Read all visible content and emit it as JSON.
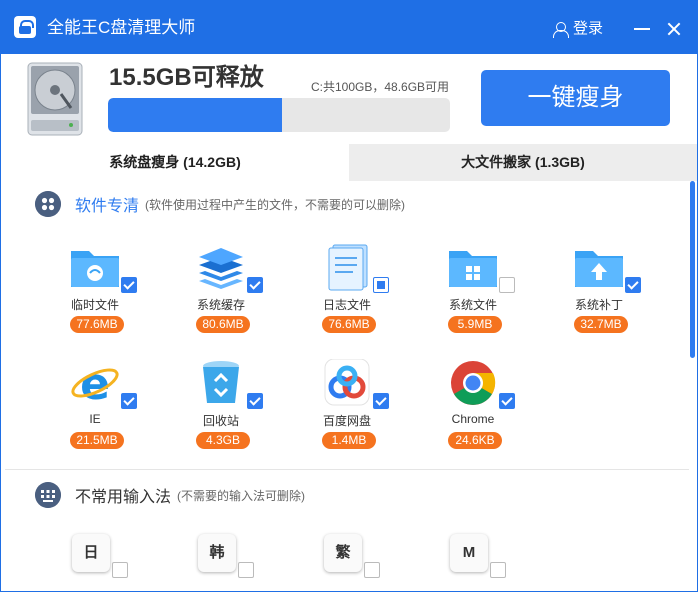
{
  "window": {
    "title": "全能王C盘清理大师",
    "login_label": "登录"
  },
  "header": {
    "free_space": "15.5GB可释放",
    "disk_info": "C:共100GB，48.6GB可用",
    "progress_fraction": 0.51,
    "slim_button": "一键瘦身"
  },
  "tabs": [
    {
      "label": "系统盘瘦身 (14.2GB)",
      "active": true
    },
    {
      "label": "大文件搬家 (1.3GB)",
      "active": false
    }
  ],
  "software_section": {
    "title": "软件专清",
    "hint": "(软件使用过程中产生的文件，不需要的可以删除)",
    "items": [
      {
        "label": "临时文件",
        "size": "77.6MB",
        "checked": true,
        "icon": "temp-folder-icon"
      },
      {
        "label": "系统缓存",
        "size": "80.6MB",
        "checked": true,
        "icon": "layers-icon"
      },
      {
        "label": "日志文件",
        "size": "76.6MB",
        "checked": "partial",
        "icon": "log-file-icon"
      },
      {
        "label": "系统文件",
        "size": "5.9MB",
        "checked": false,
        "icon": "windows-folder-icon"
      },
      {
        "label": "系统补丁",
        "size": "32.7MB",
        "checked": true,
        "icon": "patch-folder-icon"
      },
      {
        "label": "IE",
        "size": "21.5MB",
        "checked": true,
        "icon": "ie-icon"
      },
      {
        "label": "回收站",
        "size": "4.3GB",
        "checked": true,
        "icon": "recycle-bin-icon"
      },
      {
        "label": "百度网盘",
        "size": "1.4MB",
        "checked": true,
        "icon": "baidu-netdisk-icon"
      },
      {
        "label": "Chrome",
        "size": "24.6KB",
        "checked": true,
        "icon": "chrome-icon"
      }
    ]
  },
  "ime_section": {
    "title": "不常用输入法",
    "hint": "(不需要的输入法可删除)",
    "items": [
      {
        "key": "日",
        "checked": false
      },
      {
        "key": "韩",
        "checked": false
      },
      {
        "key": "繁",
        "checked": false
      },
      {
        "key": "M",
        "checked": false
      }
    ]
  },
  "colors": {
    "accent": "#2f7cf0",
    "title_bar": "#1f6fe5",
    "size_badge": "#f5731f"
  }
}
